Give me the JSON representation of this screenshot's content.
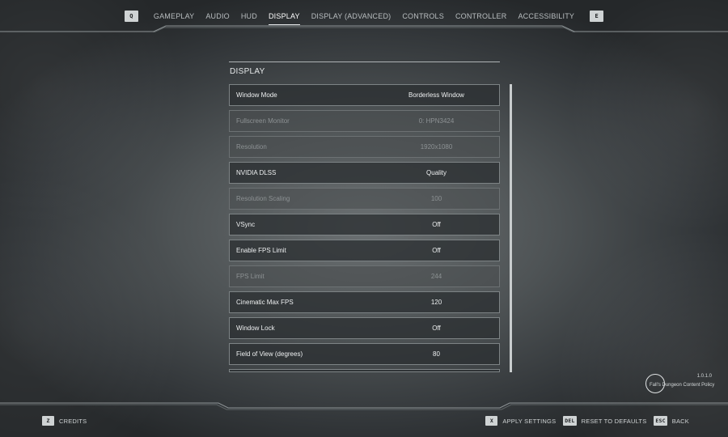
{
  "nav": {
    "prev_key": "Q",
    "next_key": "E",
    "tabs": [
      {
        "label": "GAMEPLAY"
      },
      {
        "label": "AUDIO"
      },
      {
        "label": "HUD"
      },
      {
        "label": "DISPLAY"
      },
      {
        "label": "DISPLAY (ADVANCED)"
      },
      {
        "label": "CONTROLS"
      },
      {
        "label": "CONTROLLER"
      },
      {
        "label": "ACCESSIBILITY"
      }
    ],
    "active_tab": "DISPLAY"
  },
  "panel": {
    "title": "DISPLAY",
    "rows": [
      {
        "label": "Window Mode",
        "value": "Borderless Window",
        "enabled": true
      },
      {
        "label": "Fullscreen Monitor",
        "value": "0: HPN3424",
        "enabled": false
      },
      {
        "label": "Resolution",
        "value": "1920x1080",
        "enabled": false
      },
      {
        "label": "NVIDIA DLSS",
        "value": "Quality",
        "enabled": true
      },
      {
        "label": "Resolution Scaling",
        "value": "100",
        "enabled": false
      },
      {
        "label": "VSync",
        "value": "Off",
        "enabled": true
      },
      {
        "label": "Enable FPS Limit",
        "value": "Off",
        "enabled": true
      },
      {
        "label": "FPS Limit",
        "value": "244",
        "enabled": false
      },
      {
        "label": "Cinematic Max FPS",
        "value": "120",
        "enabled": true
      },
      {
        "label": "Window Lock",
        "value": "Off",
        "enabled": true
      },
      {
        "label": "Field of View (degrees)",
        "value": "80",
        "enabled": true
      }
    ]
  },
  "badge": {
    "version": "1.0.1.0",
    "policy": "Fall's Dungeon Content Policy"
  },
  "footer": {
    "credits_key": "Z",
    "credits_label": "CREDITS",
    "apply_key": "X",
    "apply_label": "APPLY SETTINGS",
    "reset_key": "DEL",
    "reset_label": "RESET TO DEFAULTS",
    "back_key": "ESC",
    "back_label": "BACK"
  },
  "colors": {
    "row_enabled_bg": "#2c3032",
    "row_disabled_bg": "#484d4f",
    "text_primary": "#eef0f1",
    "text_disabled": "#8d9294",
    "keycap_bg": "#cfd3d4"
  },
  "icons": {
    "badge": "circle-logo-icon"
  }
}
